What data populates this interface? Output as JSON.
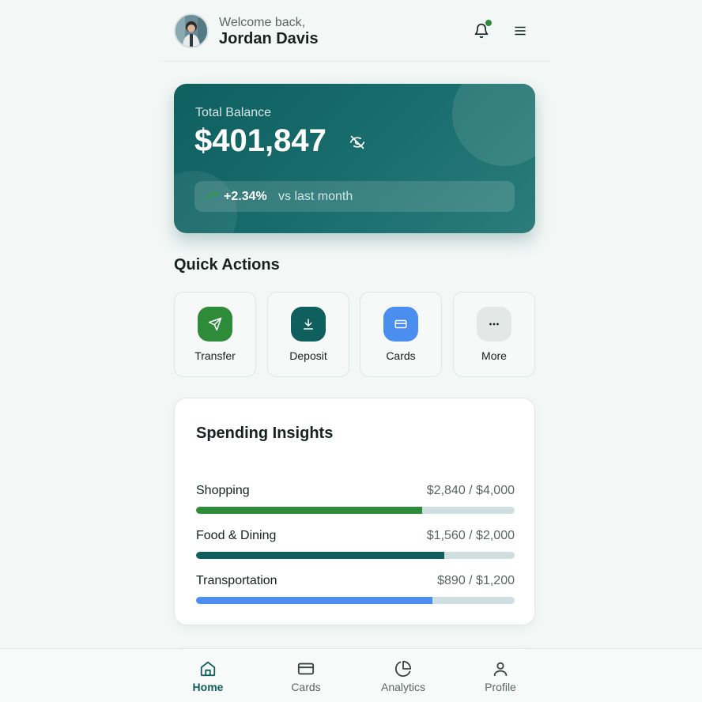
{
  "header": {
    "welcome": "Welcome back,",
    "user_name": "Jordan Davis",
    "notification_dot_color": "#2e8b3a"
  },
  "balance": {
    "label": "Total Balance",
    "amount": "$401,847",
    "change": "+2.34%",
    "change_text": "vs last month",
    "card_color": "#0f5f5f"
  },
  "quick_actions": {
    "title": "Quick Actions",
    "items": [
      {
        "label": "Transfer",
        "icon": "send-icon",
        "color": "#2e8b3a"
      },
      {
        "label": "Deposit",
        "icon": "download-icon",
        "color": "#0f5f5f"
      },
      {
        "label": "Cards",
        "icon": "credit-card-icon",
        "color": "#4a8ef0"
      },
      {
        "label": "More",
        "icon": "more-dots-icon",
        "color": "#e3e8e7"
      }
    ]
  },
  "insights": {
    "title": "Spending Insights",
    "categories": [
      {
        "name": "Shopping",
        "amount": "$2,840 / $4,000",
        "progress": 0.71,
        "color": "#2e8b3a"
      },
      {
        "name": "Food & Dining",
        "amount": "$1,560 / $2,000",
        "progress": 0.78,
        "color": "#0f5f5f"
      },
      {
        "name": "Transportation",
        "amount": "$890 / $1,200",
        "progress": 0.742,
        "color": "#4a8ef0"
      }
    ]
  },
  "nav": {
    "items": [
      {
        "label": "Home",
        "icon": "home-icon",
        "active": true
      },
      {
        "label": "Cards",
        "icon": "credit-card-icon",
        "active": false
      },
      {
        "label": "Analytics",
        "icon": "pie-chart-icon",
        "active": false
      },
      {
        "label": "Profile",
        "icon": "user-icon",
        "active": false
      }
    ]
  }
}
